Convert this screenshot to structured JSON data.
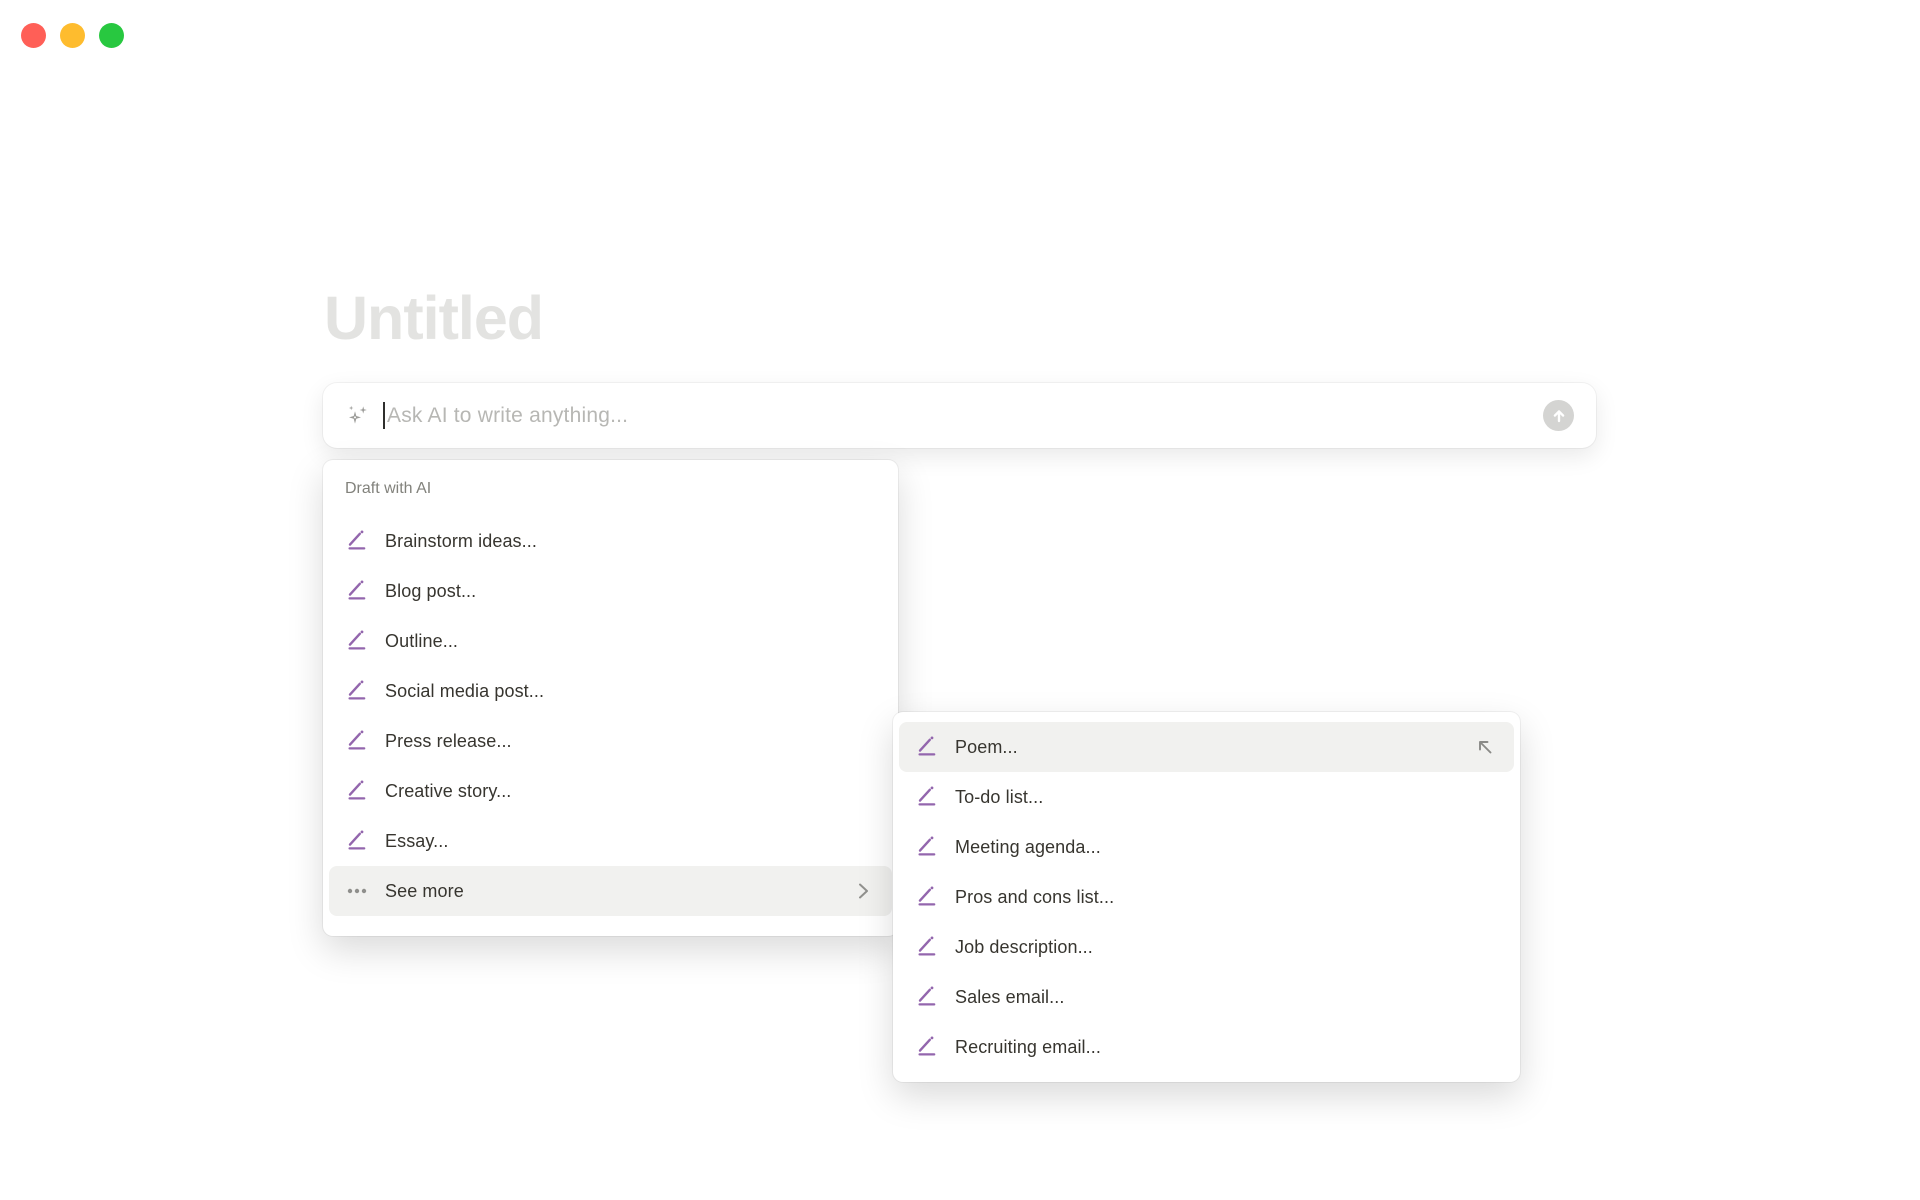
{
  "window": {
    "controls": [
      {
        "name": "close",
        "color": "#ff5f57"
      },
      {
        "name": "minimize",
        "color": "#febc2e"
      },
      {
        "name": "zoom",
        "color": "#28c840"
      }
    ]
  },
  "document": {
    "title_placeholder": "Untitled"
  },
  "ai_prompt": {
    "placeholder": "Ask AI to write anything...",
    "leading_icon": "sparkles-icon",
    "submit_icon": "arrow-up-icon"
  },
  "draft_menu": {
    "header": "Draft with AI",
    "items": [
      {
        "label": "Brainstorm ideas...",
        "icon": "pencil-icon"
      },
      {
        "label": "Blog post...",
        "icon": "pencil-icon"
      },
      {
        "label": "Outline...",
        "icon": "pencil-icon"
      },
      {
        "label": "Social media post...",
        "icon": "pencil-icon"
      },
      {
        "label": "Press release...",
        "icon": "pencil-icon"
      },
      {
        "label": "Creative story...",
        "icon": "pencil-icon"
      },
      {
        "label": "Essay...",
        "icon": "pencil-icon"
      }
    ],
    "see_more": {
      "label": "See more",
      "icon": "ellipsis-icon",
      "trailing_icon": "chevron-right-icon",
      "highlighted": true
    }
  },
  "see_more_submenu": {
    "items": [
      {
        "label": "Poem...",
        "icon": "pencil-icon",
        "highlighted": true,
        "trailing_icon": "arrow-up-left-icon"
      },
      {
        "label": "To-do list...",
        "icon": "pencil-icon"
      },
      {
        "label": "Meeting agenda...",
        "icon": "pencil-icon"
      },
      {
        "label": "Pros and cons list...",
        "icon": "pencil-icon"
      },
      {
        "label": "Job description...",
        "icon": "pencil-icon"
      },
      {
        "label": "Sales email...",
        "icon": "pencil-icon"
      },
      {
        "label": "Recruiting email...",
        "icon": "pencil-icon"
      }
    ]
  },
  "colors": {
    "accent_purple": "#9366ad",
    "menu_text": "#37352f",
    "secondary_text": "#82827c",
    "placeholder_text": "#b7b7b4",
    "highlight_bg": "#f1f1ef",
    "title_ghost_text": "#e3e3e1",
    "send_button_bg": "#d4d4d2",
    "traffic_red": "#ff5f57",
    "traffic_yellow": "#febc2e",
    "traffic_green": "#28c840"
  }
}
